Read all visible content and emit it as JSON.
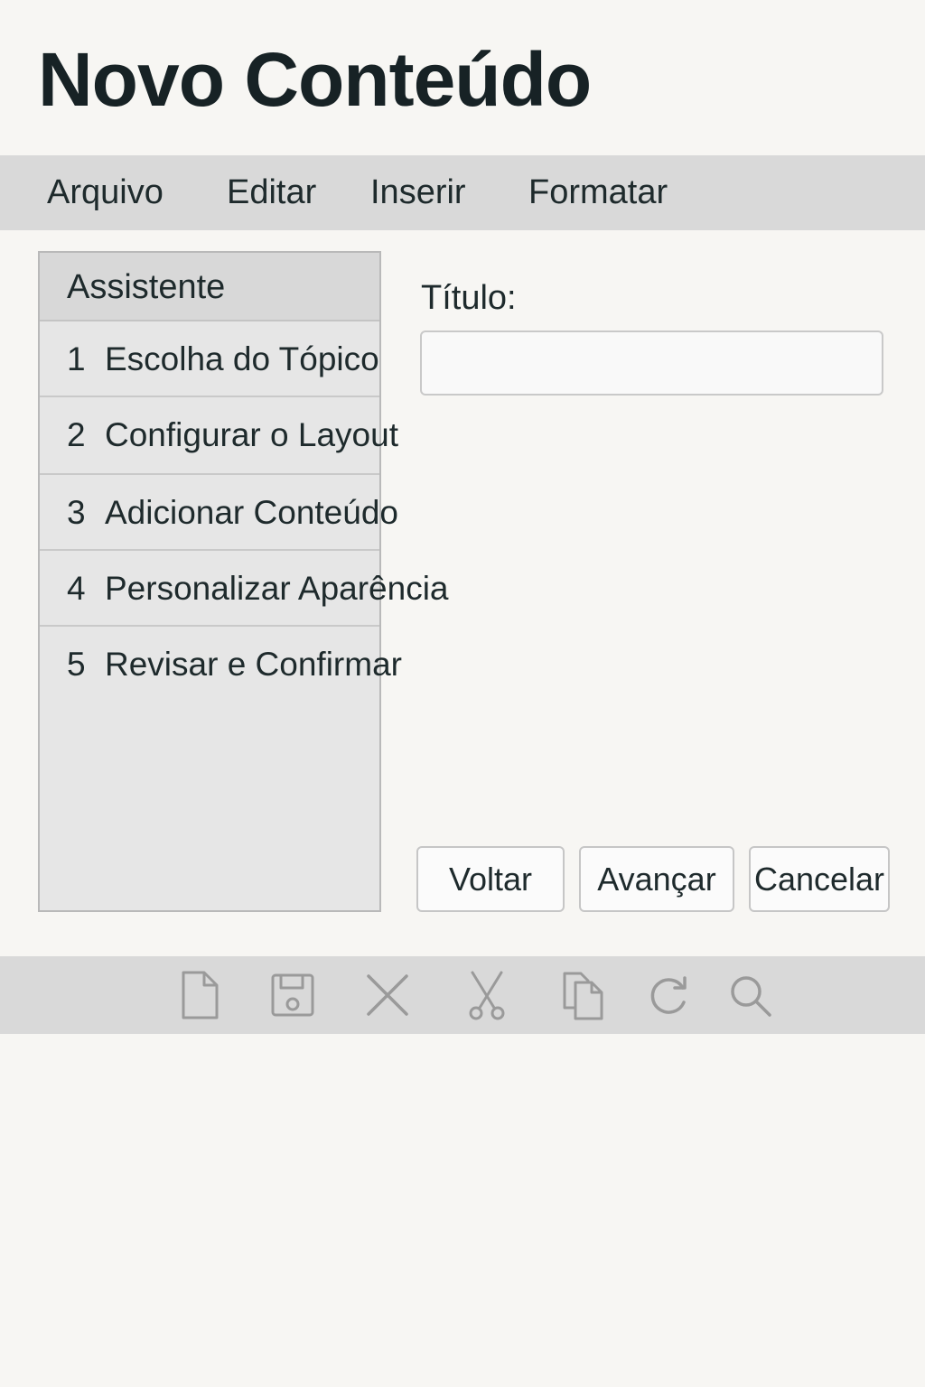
{
  "header": {
    "title": "Novo Conteúdo"
  },
  "menu": {
    "items": [
      "Arquivo",
      "Editar",
      "Inserir",
      "Formatar"
    ]
  },
  "wizard": {
    "title": "Assistente",
    "steps": [
      {
        "number": "1",
        "label": "Escolha do Tópico"
      },
      {
        "number": "2",
        "label": "Configurar o Layout"
      },
      {
        "number": "3",
        "label": "Adicionar Conteúdo"
      },
      {
        "number": "4",
        "label": "Personalizar Aparência"
      },
      {
        "number": "5",
        "label": "Revisar e Confirmar"
      }
    ]
  },
  "form": {
    "title_label": "Título:",
    "title_value": "",
    "title_placeholder": ""
  },
  "buttons": {
    "back": "Voltar",
    "next": "Avançar",
    "cancel": "Cancelar"
  },
  "toolbar": {
    "icons": [
      "new-file-icon",
      "save-icon",
      "close-icon",
      "cut-icon",
      "copy-icon",
      "refresh-icon",
      "search-icon"
    ],
    "icon_color": "#9a9a9a"
  }
}
